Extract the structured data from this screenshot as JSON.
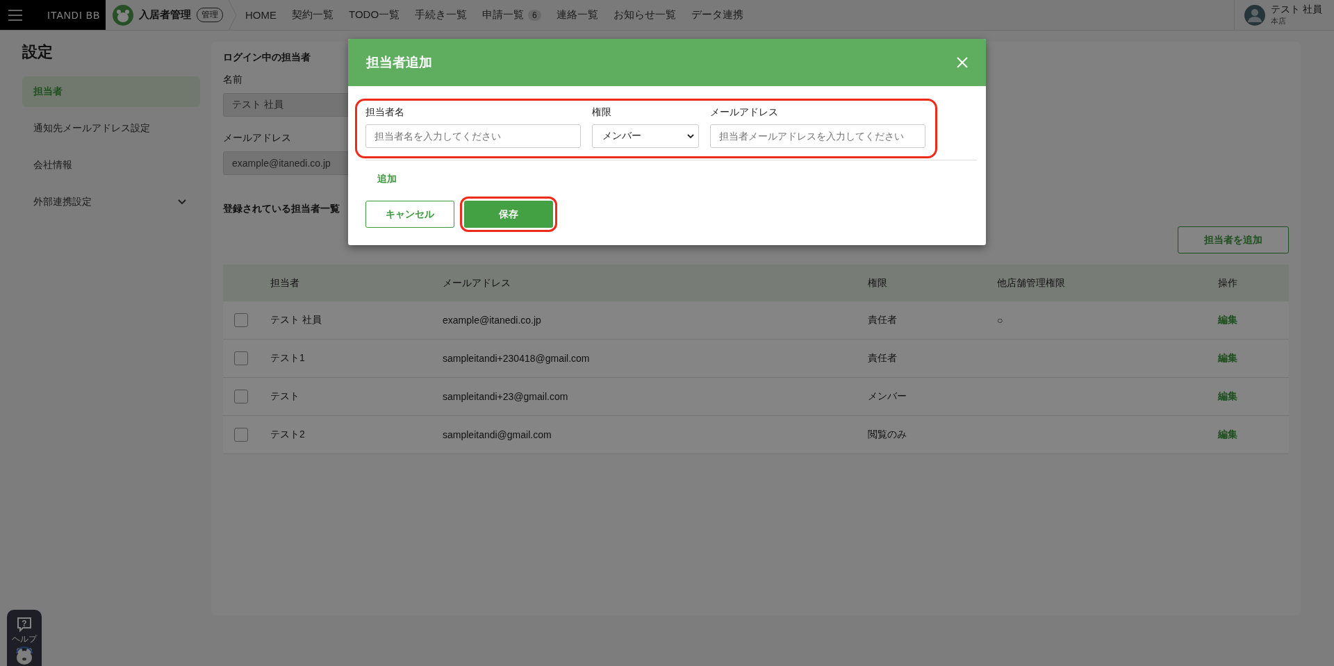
{
  "nav": {
    "brand": "ITANDI BB",
    "product": "入居者管理",
    "badge": "管理",
    "items": [
      {
        "label": "HOME"
      },
      {
        "label": "契約一覧"
      },
      {
        "label": "TODO一覧"
      },
      {
        "label": "手続き一覧"
      },
      {
        "label": "申請一覧",
        "count": "6"
      },
      {
        "label": "連絡一覧"
      },
      {
        "label": "お知らせ一覧"
      },
      {
        "label": "データ連携"
      }
    ],
    "user": {
      "name": "テスト 社員",
      "store": "本店"
    }
  },
  "sidebar": {
    "title": "設定",
    "items": [
      {
        "label": "担当者",
        "selected": true,
        "kind": "link"
      },
      {
        "label": "通知先メールアドレス設定",
        "selected": false,
        "kind": "link"
      },
      {
        "label": "会社情報",
        "selected": false,
        "kind": "link"
      },
      {
        "label": "外部連携設定",
        "selected": false,
        "kind": "group"
      }
    ]
  },
  "content": {
    "login_title": "ログイン中の担当者",
    "name_label": "名前",
    "name_value": "テスト 社員",
    "email_label": "メールアドレス",
    "email_value": "example@itanedi.co.jp",
    "list_title": "登録されている担当者一覧",
    "add_button": "担当者を追加"
  },
  "table": {
    "columns": [
      "担当者",
      "メールアドレス",
      "権限",
      "他店舗管理権限",
      "操作"
    ],
    "rows": [
      {
        "checked": false,
        "name": "テスト 社員",
        "email": "example@itanedi.co.jp",
        "role": "責任者",
        "other_store": "○",
        "action": "編集"
      },
      {
        "checked": false,
        "name": "テスト1",
        "email": "sampleitandi+230418@gmail.com",
        "role": "責任者",
        "action": "編集"
      },
      {
        "checked": false,
        "name": "テスト",
        "email": "sampleitandi+23@gmail.com",
        "role": "メンバー",
        "action": "編集"
      },
      {
        "checked": false,
        "name": "テスト2",
        "email": "sampleitandi@gmail.com",
        "role": "閲覧のみ",
        "action": "編集"
      }
    ]
  },
  "modal": {
    "title": "担当者追加",
    "fields": [
      {
        "kind": "text",
        "label": "担当者名",
        "placeholder": "担当者名を入力してください"
      },
      {
        "kind": "select",
        "label": "権限",
        "value": "メンバー"
      },
      {
        "kind": "text",
        "label": "メールアドレス",
        "placeholder": "担当者メールアドレスを入力してください"
      }
    ],
    "add_link": "追加",
    "cancel": "キャンセル",
    "save": "保存"
  },
  "help": {
    "icon": "?",
    "label": "ヘルプ"
  }
}
